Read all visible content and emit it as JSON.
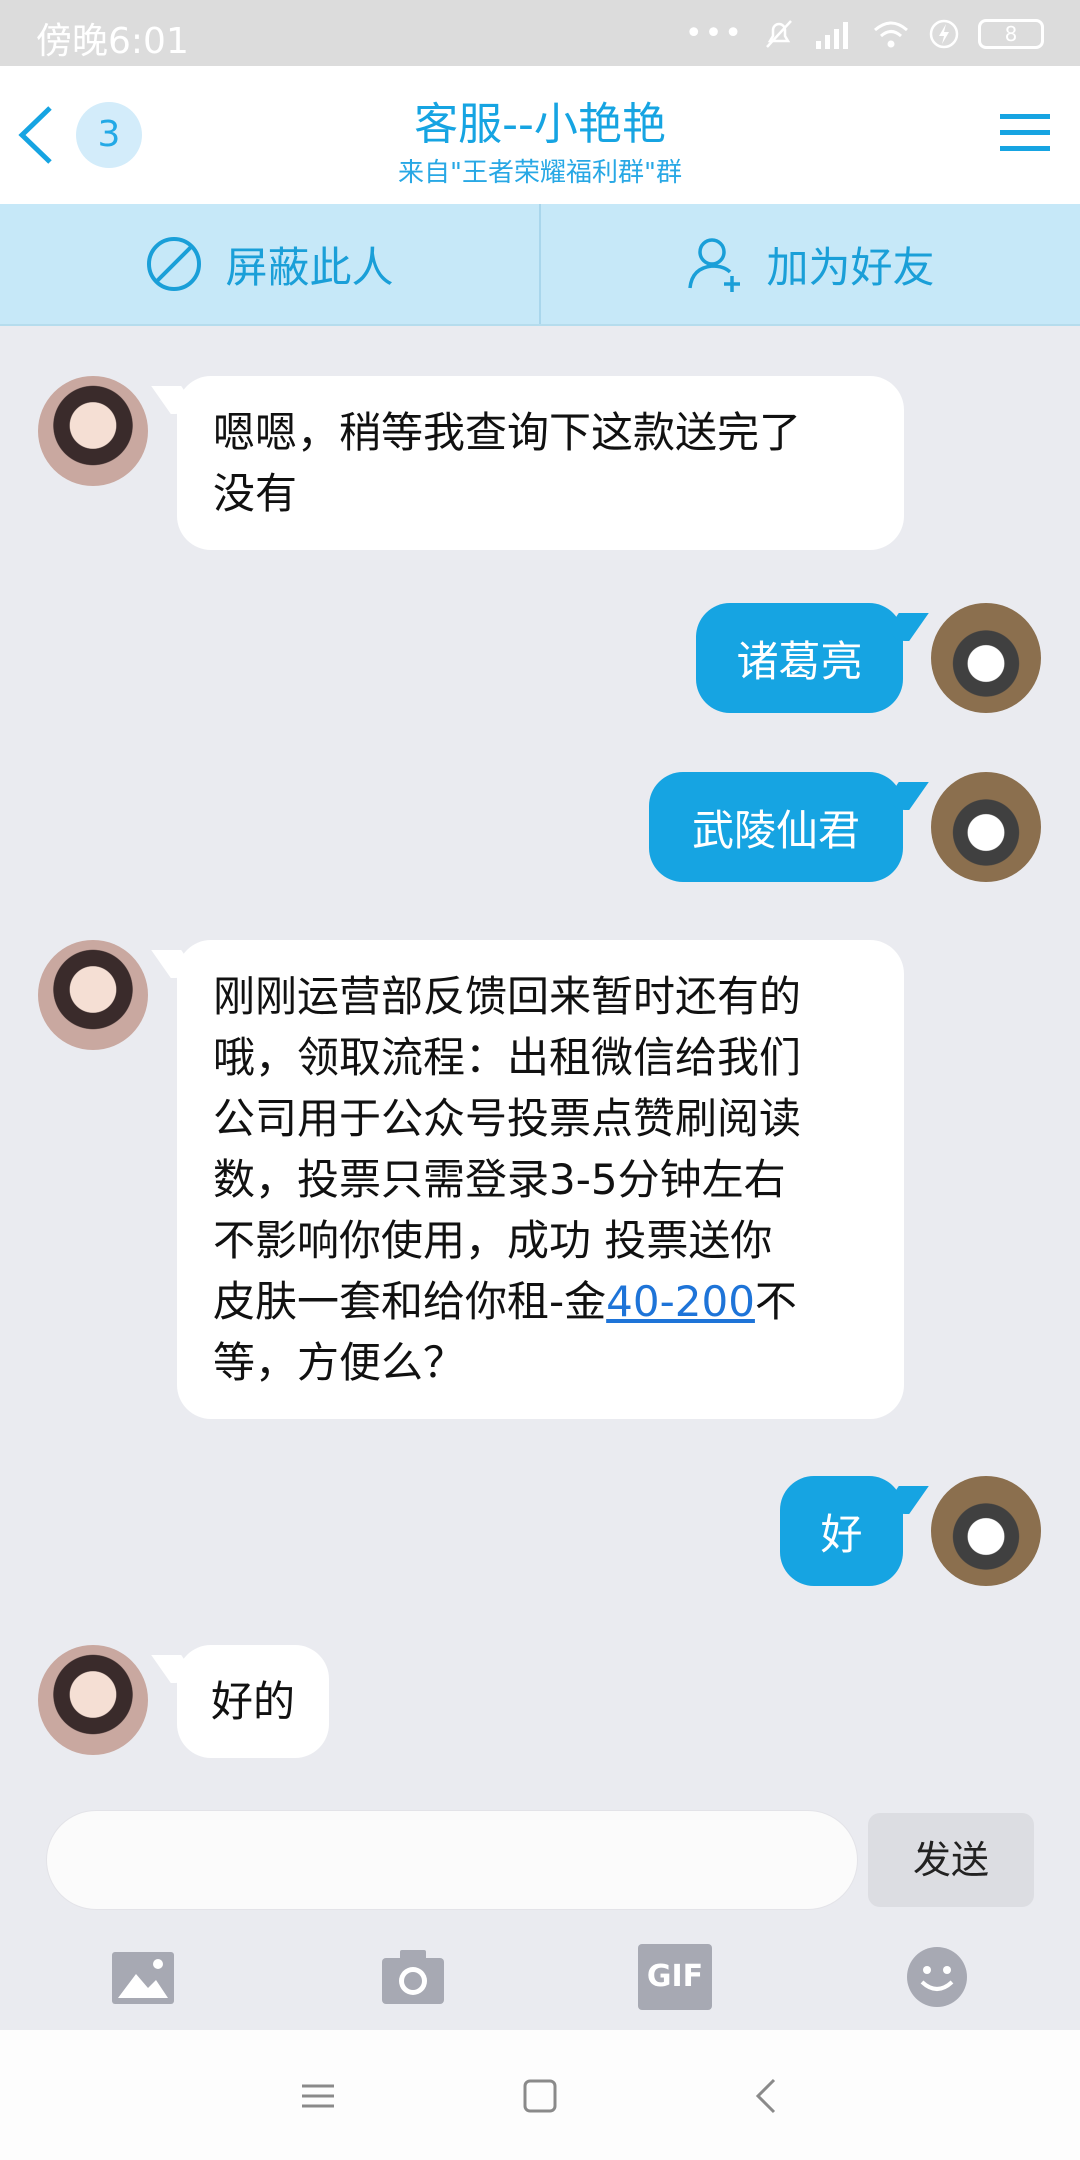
{
  "status_bar": {
    "time": "傍晚6:01",
    "battery": "8"
  },
  "header": {
    "back_icon": "chevron-left-icon",
    "unread_count": "3",
    "title": "客服--小艳艳",
    "subtitle": "来自\"王者荣耀福利群\"群",
    "menu_icon": "menu-icon"
  },
  "actions": {
    "block_label": "屏蔽此人",
    "block_icon": "block-icon",
    "add_friend_label": "加为好友",
    "add_friend_icon": "add-person-icon"
  },
  "messages": [
    {
      "sender": "other",
      "lines": [
        "嗯嗯，稍等我查询下这款送完了",
        "没有"
      ]
    },
    {
      "sender": "me",
      "text": "诸葛亮"
    },
    {
      "sender": "me",
      "text": "武陵仙君"
    },
    {
      "sender": "other",
      "lines": [
        "刚刚运营部反馈回来暂时还有的",
        "哦，领取流程：出租微信给我们",
        "公司用于公众号投票点赞刷阅读",
        "数，投票只需登录3-5分钟左右",
        "不影响你使用，成功 投票送你"
      ],
      "line6_before": "皮肤一套和给你租-金",
      "line6_link": "40-200",
      "line6_after": "不",
      "line7": "等，方便么？"
    },
    {
      "sender": "me",
      "text": "好"
    },
    {
      "sender": "other",
      "text": "好的"
    }
  ],
  "input": {
    "placeholder": "",
    "send_label": "发送"
  },
  "toolbar": {
    "icons": [
      "image-icon",
      "camera-icon",
      "gif-icon",
      "emoji-icon"
    ],
    "gif_text": "GIF"
  },
  "colors": {
    "accent": "#16a4e2",
    "action_bar": "#c6e8f8",
    "chat_bg": "#eaebf0"
  }
}
